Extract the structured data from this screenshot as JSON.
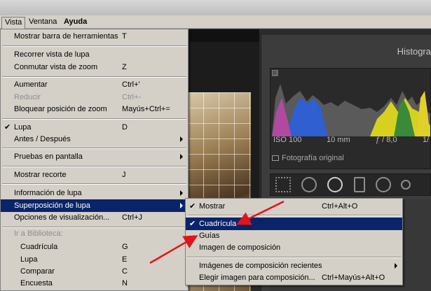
{
  "menubar": {
    "items": [
      {
        "label": "Vista",
        "active": true,
        "bold": false
      },
      {
        "label": "Ventana",
        "active": false,
        "bold": false
      },
      {
        "label": "Ayuda",
        "active": false,
        "bold": true
      }
    ]
  },
  "background": {
    "histogram_title": "Histogra",
    "info": {
      "iso": "ISO 100",
      "focal": "10 mm",
      "aperture": "ƒ / 8,0",
      "extra": "1/"
    },
    "original_photo_label": "Fotografía original"
  },
  "vista_menu": {
    "items": [
      {
        "label": "Mostrar barra de herramientas",
        "shortcut": "T"
      },
      {
        "label": "Recorrer vista de lupa",
        "shortcut": ""
      },
      {
        "label": "Conmutar vista de zoom",
        "shortcut": "Z"
      },
      {
        "label": "Aumentar",
        "shortcut": "Ctrl+'"
      },
      {
        "label": "Reducir",
        "shortcut": "Ctrl+-",
        "disabled": true
      },
      {
        "label": "Bloquear posición de zoom",
        "shortcut": "Mayús+Ctrl+="
      },
      {
        "label": "Lupa",
        "shortcut": "D",
        "checked": true
      },
      {
        "label": "Antes / Después",
        "shortcut": "",
        "submenu": true
      },
      {
        "label": "Pruebas en pantalla",
        "shortcut": "",
        "submenu": true
      },
      {
        "label": "Mostrar recorte",
        "shortcut": "J"
      },
      {
        "label": "Información de lupa",
        "shortcut": "",
        "submenu": true
      },
      {
        "label": "Superposición de lupa",
        "shortcut": "",
        "submenu": true,
        "highlighted": true
      },
      {
        "label": "Opciones de visualización...",
        "shortcut": "Ctrl+J"
      }
    ],
    "library_section": "Ir a Biblioteca:",
    "library_items": [
      {
        "label": "Cuadrícula",
        "shortcut": "G"
      },
      {
        "label": "Lupa",
        "shortcut": "E"
      },
      {
        "label": "Comparar",
        "shortcut": "C"
      },
      {
        "label": "Encuesta",
        "shortcut": "N"
      }
    ]
  },
  "overlay_submenu": {
    "items": [
      {
        "label": "Mostrar",
        "shortcut": "Ctrl+Alt+O",
        "checked": true
      },
      {
        "label": "Cuadrícula",
        "shortcut": "",
        "checked": true,
        "highlighted": true
      },
      {
        "label": "Guías",
        "shortcut": ""
      },
      {
        "label": "Imagen de composición",
        "shortcut": ""
      },
      {
        "label": "Imágenes de composición recientes",
        "shortcut": "",
        "submenu": true
      },
      {
        "label": "Elegir imagen para composición...",
        "shortcut": "Ctrl+Mayús+Alt+O"
      }
    ]
  },
  "colors": {
    "highlight": "#0a246a",
    "menu_bg": "#d4d0c8",
    "annotation_arrow": "#e0151b"
  },
  "icons": [
    "checkmark-icon",
    "submenu-arrow-icon",
    "grid-tool-icon",
    "crop-tool-icon",
    "spot-tool-icon",
    "redeye-tool-icon",
    "gradient-tool-icon",
    "brush-tool-icon"
  ]
}
